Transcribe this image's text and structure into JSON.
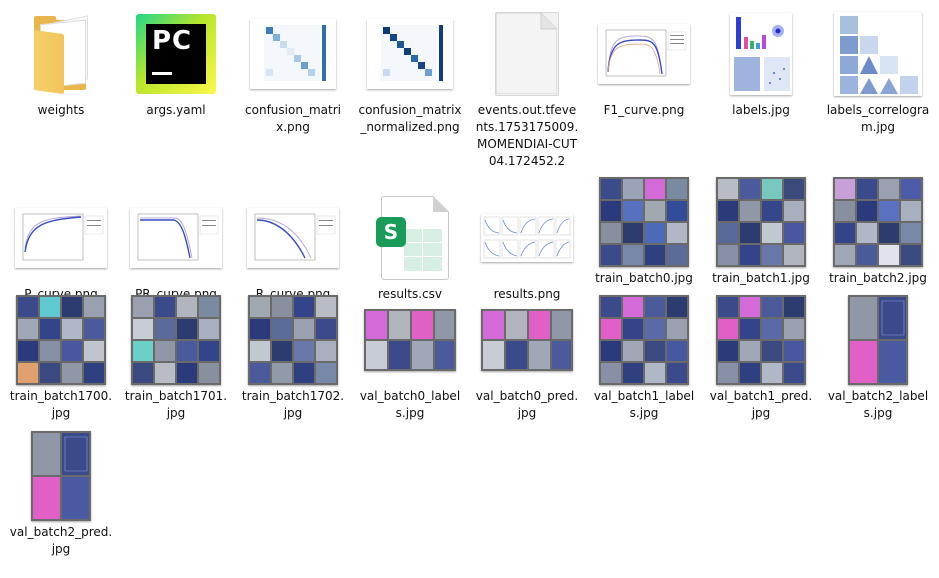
{
  "files": [
    {
      "id": "weights",
      "label": "weights",
      "type": "folder",
      "icon": "folder-icon"
    },
    {
      "id": "args",
      "label": "args.yaml",
      "type": "app",
      "icon": "pycharm-icon"
    },
    {
      "id": "cm",
      "label": "confusion_matrix.png",
      "type": "thumb-cm"
    },
    {
      "id": "cmn",
      "label": "confusion_matrix_normalized.png",
      "type": "thumb-cmn"
    },
    {
      "id": "events",
      "label": "events.out.tfevents.1753175009.MOMENDIAI-CUT04.172452.2",
      "type": "doc",
      "icon": "document-icon"
    },
    {
      "id": "f1",
      "label": "F1_curve.png",
      "type": "thumb-curve"
    },
    {
      "id": "labels",
      "label": "labels.jpg",
      "type": "thumb-labels"
    },
    {
      "id": "corr",
      "label": "labels_correlogram.jpg",
      "type": "thumb-corr"
    },
    {
      "id": "p",
      "label": "P_curve.png",
      "type": "thumb-curve"
    },
    {
      "id": "pr",
      "label": "PR_curve.png",
      "type": "thumb-curve"
    },
    {
      "id": "r",
      "label": "R_curve.png",
      "type": "thumb-curve"
    },
    {
      "id": "results_csv",
      "label": "results.csv",
      "type": "csv",
      "icon": "spreadsheet-icon"
    },
    {
      "id": "results_png",
      "label": "results.png",
      "type": "thumb-results"
    },
    {
      "id": "tb0",
      "label": "train_batch0.jpg",
      "type": "thumb-photo"
    },
    {
      "id": "tb1",
      "label": "train_batch1.jpg",
      "type": "thumb-photo"
    },
    {
      "id": "tb2",
      "label": "train_batch2.jpg",
      "type": "thumb-photo"
    },
    {
      "id": "tb1700",
      "label": "train_batch1700.jpg",
      "type": "thumb-photo"
    },
    {
      "id": "tb1701",
      "label": "train_batch1701.jpg",
      "type": "thumb-photo"
    },
    {
      "id": "tb1702",
      "label": "train_batch1702.jpg",
      "type": "thumb-photo"
    },
    {
      "id": "vb0l",
      "label": "val_batch0_labels.jpg",
      "type": "thumb-wide"
    },
    {
      "id": "vb0p",
      "label": "val_batch0_pred.jpg",
      "type": "thumb-wide"
    },
    {
      "id": "vb1l",
      "label": "val_batch1_labels.jpg",
      "type": "thumb-photo"
    },
    {
      "id": "vb1p",
      "label": "val_batch1_pred.jpg",
      "type": "thumb-photo"
    },
    {
      "id": "vb2l",
      "label": "val_batch2_labels.jpg",
      "type": "thumb-tall"
    },
    {
      "id": "vb2p",
      "label": "val_batch2_pred.jpg",
      "type": "thumb-tall"
    }
  ]
}
